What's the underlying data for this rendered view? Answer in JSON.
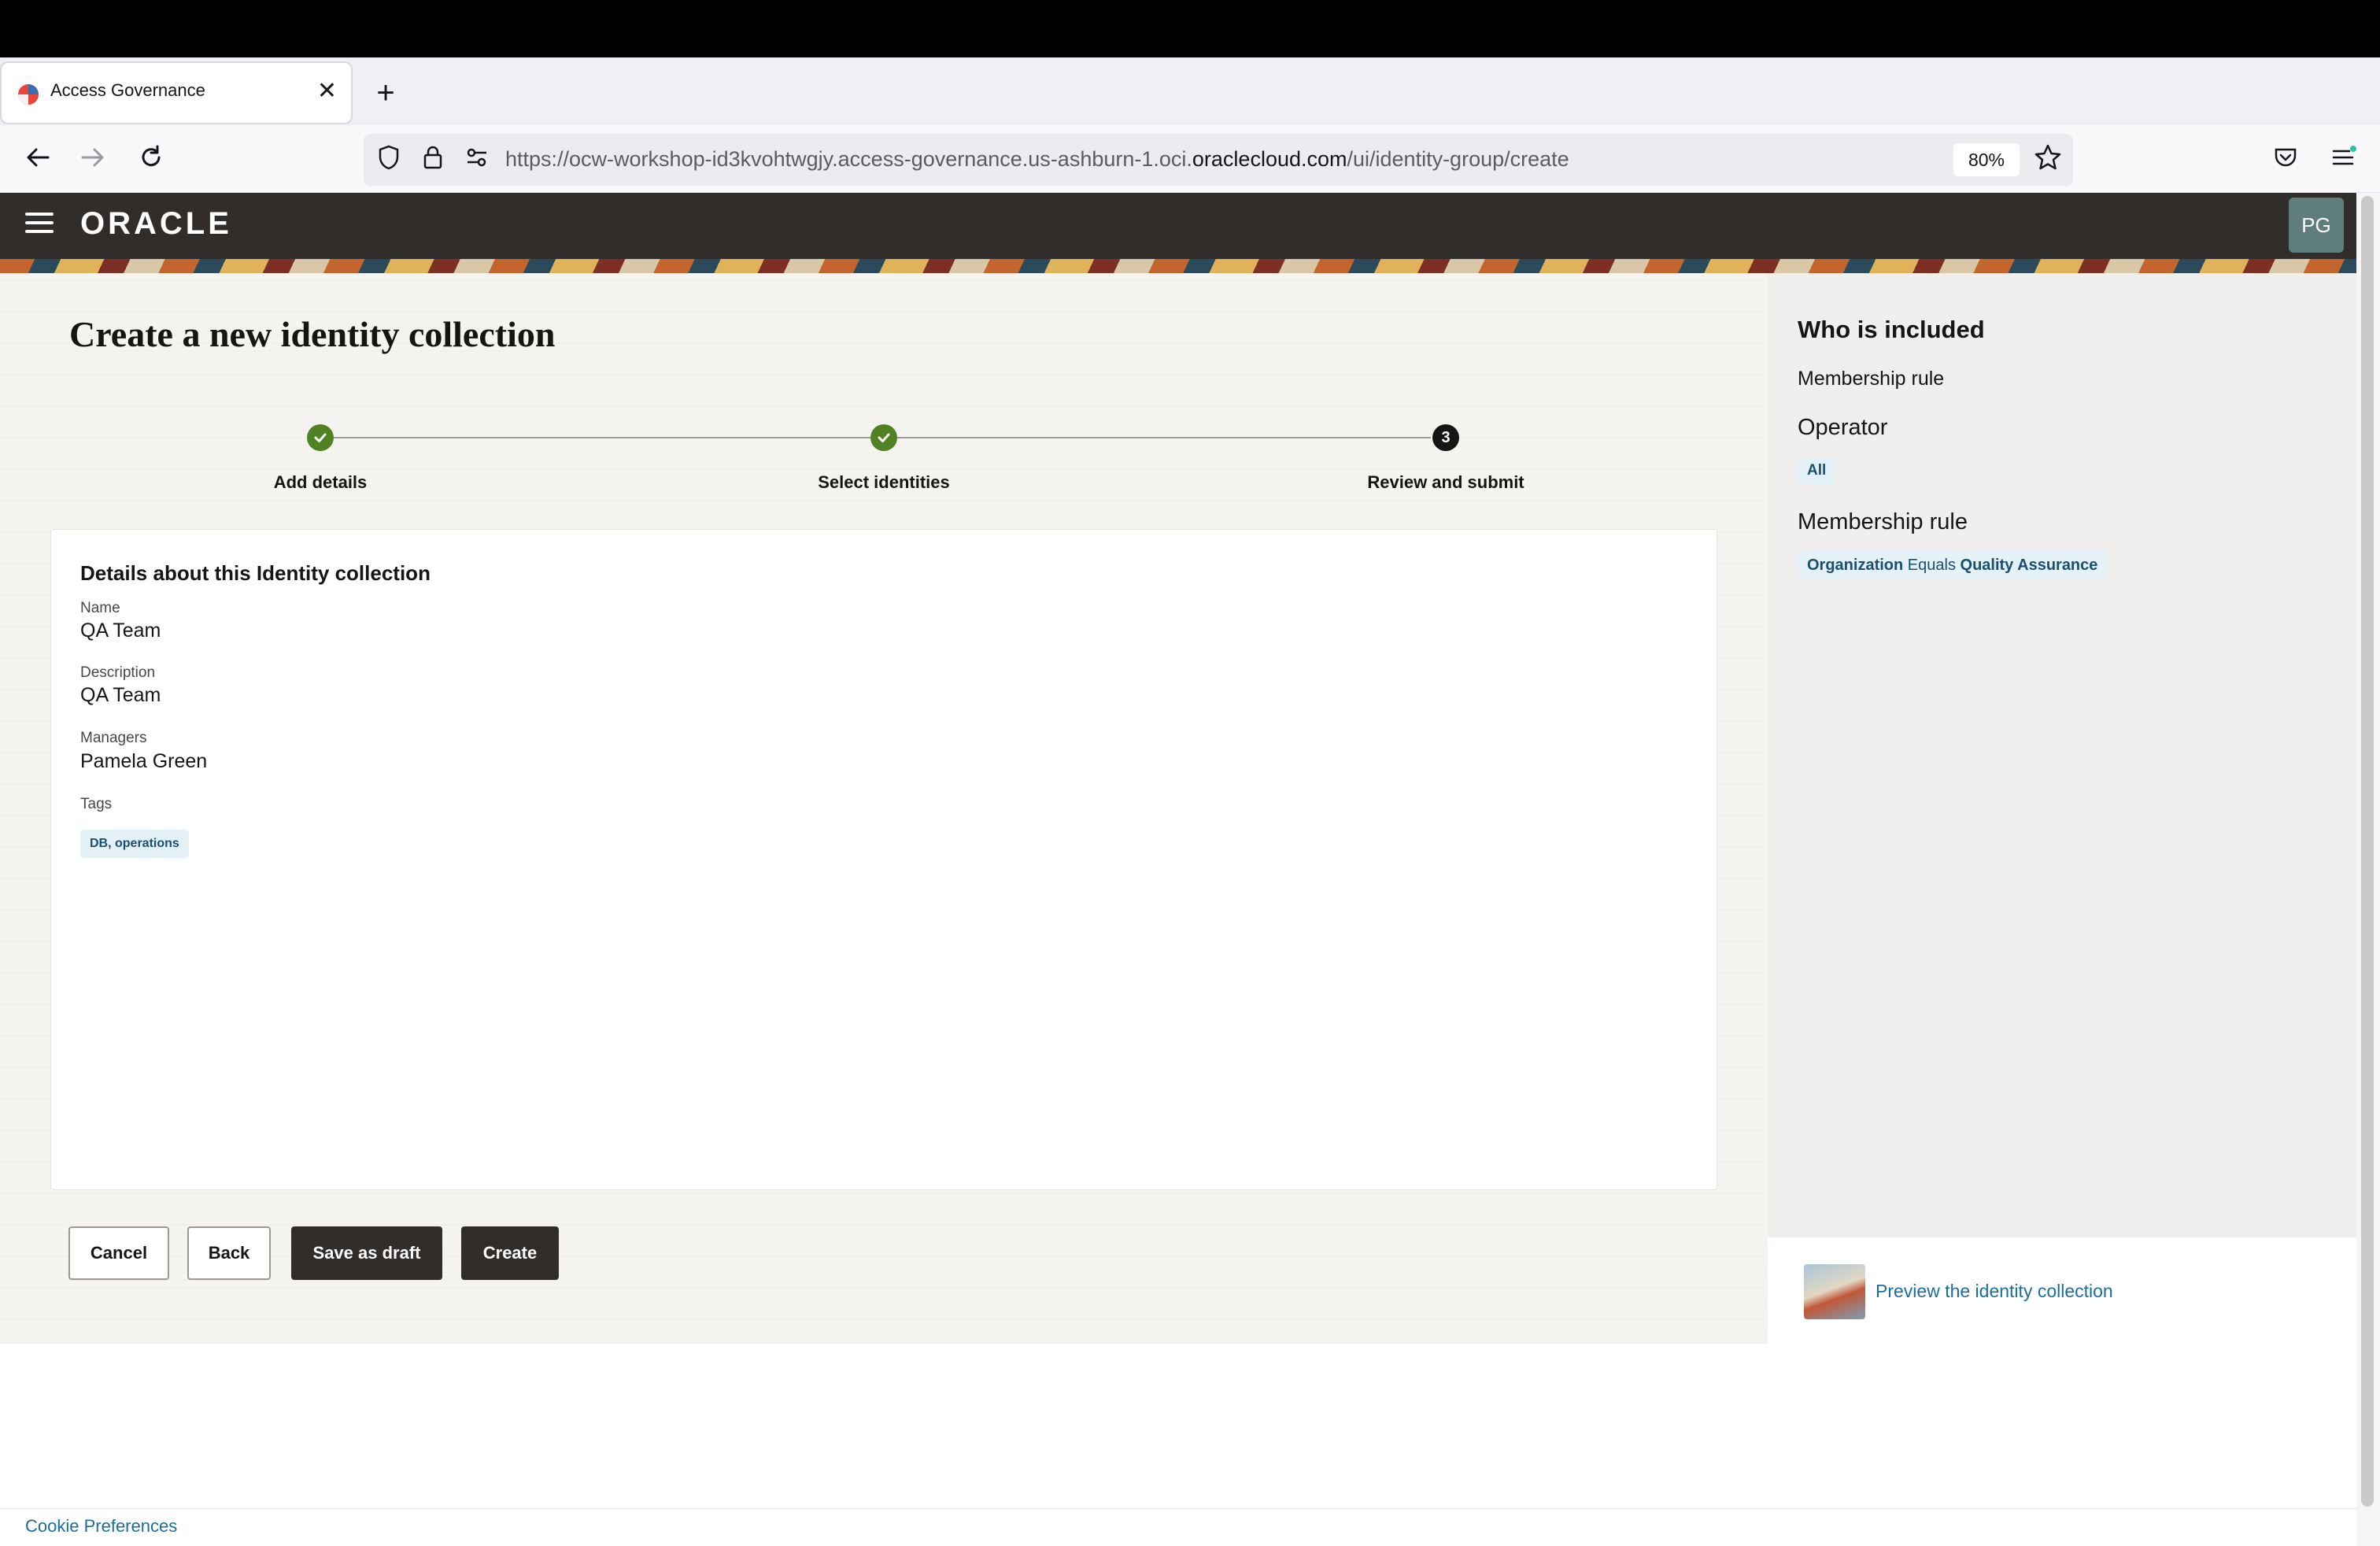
{
  "browser": {
    "tab_title": "Access Governance",
    "tab_close": "✕",
    "new_tab": "+",
    "url_prefix": "https://ocw-workshop-id3kvohtwgjy.access-governance.us-ashburn-1.oci.",
    "url_domain": "oraclecloud.com",
    "url_path": "/ui/identity-group/create",
    "zoom": "80%"
  },
  "header": {
    "logo": "ORACLE",
    "avatar_initials": "PG"
  },
  "page": {
    "title": "Create a new identity collection"
  },
  "steps": [
    {
      "label": "Add details",
      "status": "done"
    },
    {
      "label": "Select identities",
      "status": "done"
    },
    {
      "label": "Review and submit",
      "status": "current",
      "number": "3"
    }
  ],
  "details": {
    "heading": "Details about this Identity collection",
    "name_label": "Name",
    "name_value": "QA Team",
    "description_label": "Description",
    "description_value": "QA Team",
    "managers_label": "Managers",
    "managers_value": "Pamela Green",
    "tags_label": "Tags",
    "tags_value": "DB, operations"
  },
  "actions": {
    "cancel": "Cancel",
    "back": "Back",
    "save_draft": "Save as draft",
    "create": "Create"
  },
  "side_panel": {
    "title": "Who is included",
    "subtitle": "Membership rule",
    "operator_heading": "Operator",
    "operator_value": "All",
    "rule_heading": "Membership rule",
    "rule_attribute": "Organization",
    "rule_operator": "Equals",
    "rule_value": "Quality Assurance",
    "preview_link": "Preview the identity collection"
  },
  "footer": {
    "cookie_link": "Cookie Preferences"
  },
  "colors": {
    "header_bg": "#312d2a",
    "step_done": "#508223",
    "link": "#1b6e9c",
    "chip_bg": "#e4f1f6"
  }
}
